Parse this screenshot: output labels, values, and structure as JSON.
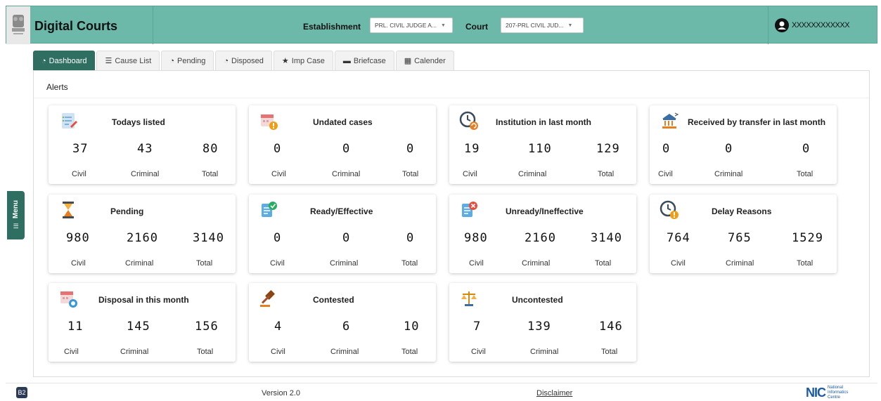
{
  "header": {
    "title": "Digital Courts",
    "establishment_label": "Establishment",
    "establishment_value": "PRL. CIVIL JUDGE A...",
    "court_label": "Court",
    "court_value": "207-PRL CIVIL JUD...",
    "user_name": "XXXXXXXXXXXX"
  },
  "menu": {
    "label": "Menu"
  },
  "tabs": [
    {
      "label": "Dashboard",
      "icon": "dashboard-icon"
    },
    {
      "label": "Cause List",
      "icon": "list-icon"
    },
    {
      "label": "Pending",
      "icon": "dashboard-icon"
    },
    {
      "label": "Disposed",
      "icon": "dashboard-icon"
    },
    {
      "label": "Imp Case",
      "icon": "star-icon"
    },
    {
      "label": "Briefcase",
      "icon": "briefcase-icon"
    },
    {
      "label": "Calender",
      "icon": "calendar-icon"
    }
  ],
  "alerts": {
    "title": "Alerts",
    "cards": [
      {
        "title": "Todays listed",
        "icon": "checklist-icon",
        "values": [
          "37",
          "43",
          "80"
        ],
        "labels": [
          "Civil",
          "Criminal",
          "Total"
        ]
      },
      {
        "title": "Undated cases",
        "icon": "calendar-warning-icon",
        "values": [
          "0",
          "0",
          "0"
        ],
        "labels": [
          "Civil",
          "Criminal",
          "Total"
        ]
      },
      {
        "title": "Institution in last month",
        "icon": "clock-refresh-icon",
        "values": [
          "19",
          "110",
          "129"
        ],
        "labels": [
          "Civil",
          "Criminal",
          "Total"
        ]
      },
      {
        "title": "Received by transfer in last month",
        "icon": "court-transfer-icon",
        "values": [
          "0",
          "0",
          "0"
        ],
        "labels": [
          "Civil",
          "Criminal",
          "Total"
        ]
      },
      {
        "title": "Pending",
        "icon": "hourglass-icon",
        "values": [
          "980",
          "2160",
          "3140"
        ],
        "labels": [
          "Civil",
          "Criminal",
          "Total"
        ]
      },
      {
        "title": "Ready/Effective",
        "icon": "document-check-icon",
        "values": [
          "0",
          "0",
          "0"
        ],
        "labels": [
          "Civil",
          "Criminal",
          "Total"
        ]
      },
      {
        "title": "Unready/Ineffective",
        "icon": "document-cross-icon",
        "values": [
          "980",
          "2160",
          "3140"
        ],
        "labels": [
          "Civil",
          "Criminal",
          "Total"
        ]
      },
      {
        "title": "Delay Reasons",
        "icon": "clock-warning-icon",
        "values": [
          "764",
          "765",
          "1529"
        ],
        "labels": [
          "Civil",
          "Criminal",
          "Total"
        ]
      },
      {
        "title": "Disposal in this month",
        "icon": "calendar-clock-icon",
        "values": [
          "11",
          "145",
          "156"
        ],
        "labels": [
          "Civil",
          "Criminal",
          "Total"
        ]
      },
      {
        "title": "Contested",
        "icon": "gavel-icon",
        "values": [
          "4",
          "6",
          "10"
        ],
        "labels": [
          "Civil",
          "Criminal",
          "Total"
        ]
      },
      {
        "title": "Uncontested",
        "icon": "scales-icon",
        "values": [
          "7",
          "139",
          "146"
        ],
        "labels": [
          "Civil",
          "Criminal",
          "Total"
        ]
      }
    ]
  },
  "footer": {
    "badge": "B2",
    "version": "Version 2.0",
    "disclaimer": "Disclaimer",
    "nic_logo": "NIC",
    "nic_text_1": "National",
    "nic_text_2": "Informatics",
    "nic_text_3": "Centre"
  },
  "colors": {
    "header_bg": "#6cb9aa",
    "active_tab": "#2f6f62",
    "menu_tab": "#2f6f62"
  }
}
